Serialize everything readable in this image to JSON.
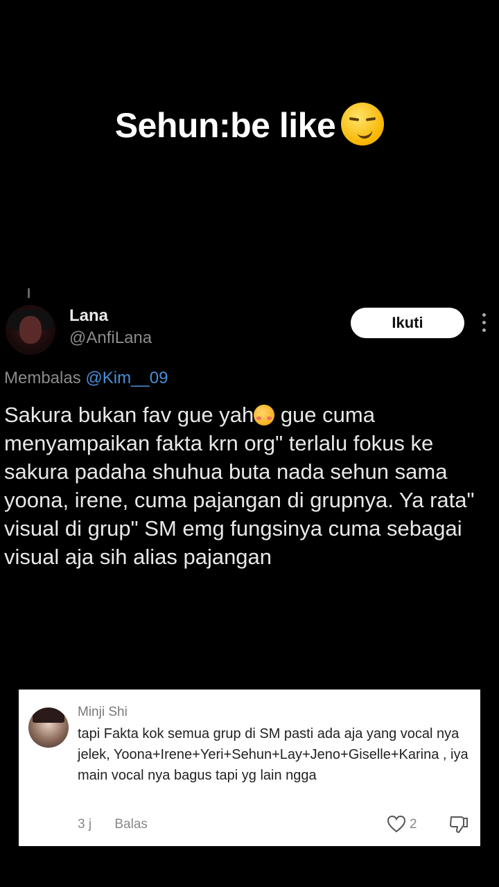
{
  "caption": {
    "text": "Sehun:be like",
    "emoji": "smirking-face-emoji"
  },
  "tweet": {
    "name": "Lana",
    "handle": "@AnfiLana",
    "follow_label": "Ikuti",
    "reply_prefix": "Membalas",
    "reply_mention": "@Kim__09",
    "body_part1": "Sakura bukan fav gue yah",
    "body_emoji": "flushed-face-emoji",
    "body_part2": " gue cuma menyampaikan fakta krn org\" terlalu fokus ke sakura padaha shuhua buta nada sehun sama yoona, irene, cuma pajangan di grupnya. Ya rata\" visual di grup\" SM emg fungsinya cuma sebagai visual aja sih alias pajangan"
  },
  "comment": {
    "name": "Minji Shi",
    "text": "tapi Fakta kok semua grup di SM pasti ada aja yang vocal nya jelek, Yoona+Irene+Yeri+Sehun+Lay+Jeno+Giselle+Karina , iya main vocal nya bagus tapi yg lain ngga",
    "time": "3 j",
    "reply_label": "Balas",
    "likes": "2"
  },
  "colors": {
    "background": "#000000",
    "mention": "#4a8fd8",
    "card": "#ffffff"
  }
}
